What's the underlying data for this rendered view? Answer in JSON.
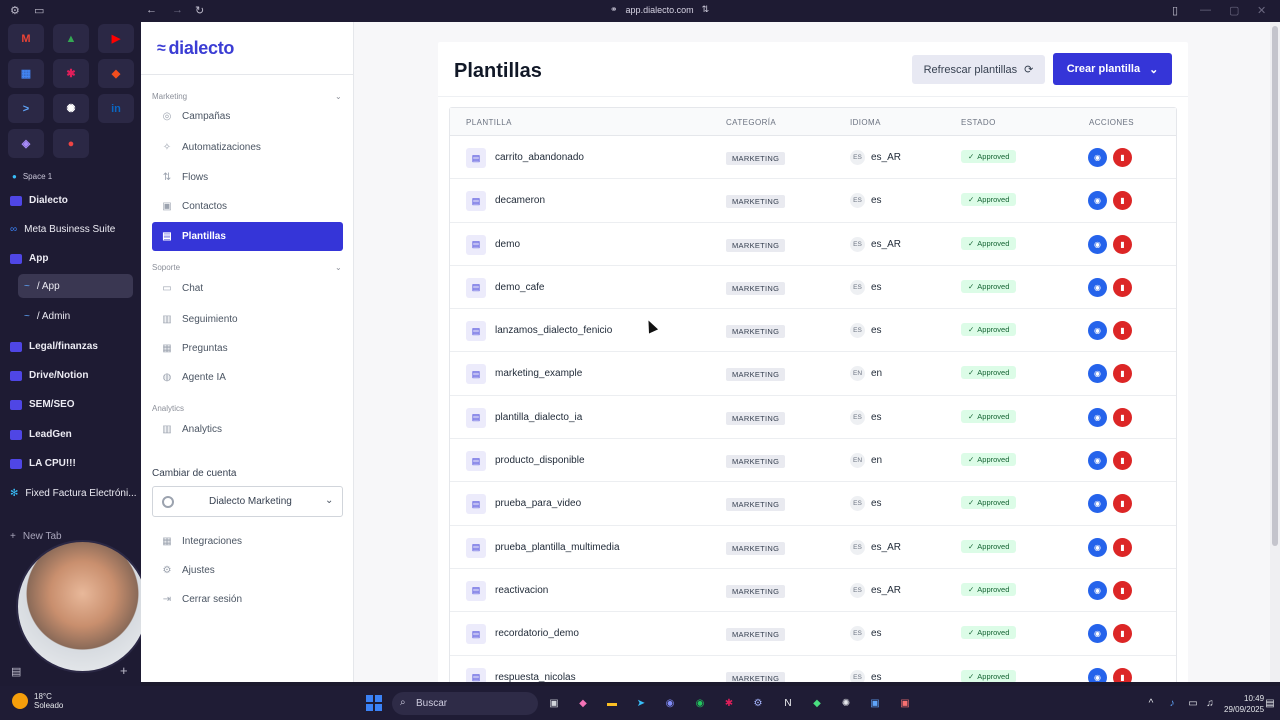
{
  "browser": {
    "url": "app.dialecto.com"
  },
  "arc_sidebar": {
    "space": "Space 1",
    "items": [
      {
        "label": "Dialecto"
      },
      {
        "label": "Meta Business Suite"
      },
      {
        "label": "App"
      },
      {
        "label": "/  App"
      },
      {
        "label": "/  Admin"
      },
      {
        "label": "Legal/finanzas"
      },
      {
        "label": "Drive/Notion"
      },
      {
        "label": "SEM/SEO"
      },
      {
        "label": "LeadGen"
      },
      {
        "label": "LA CPU!!!"
      },
      {
        "label": "Fixed Factura Electróni..."
      },
      {
        "label": "New Tab"
      }
    ]
  },
  "app": {
    "logo": "dialecto",
    "sidebar": {
      "sections": {
        "marketing": "Marketing",
        "soporte": "Soporte",
        "analytics": "Analytics"
      },
      "items": [
        {
          "label": "Campañas"
        },
        {
          "label": "Automatizaciones"
        },
        {
          "label": "Flows"
        },
        {
          "label": "Contactos"
        },
        {
          "label": "Plantillas"
        },
        {
          "label": "Chat"
        },
        {
          "label": "Seguimiento"
        },
        {
          "label": "Preguntas"
        },
        {
          "label": "Agente IA"
        },
        {
          "label": "Analytics"
        }
      ],
      "switch_account_label": "Cambiar de cuenta",
      "account": "Dialecto Marketing",
      "footer": [
        {
          "label": "Integraciones"
        },
        {
          "label": "Ajustes"
        },
        {
          "label": "Cerrar sesión"
        }
      ]
    },
    "main": {
      "title": "Plantillas",
      "refresh_label": "Refrescar plantillas",
      "create_label": "Crear plantilla",
      "columns": [
        "PLANTILLA",
        "CATEGORÍA",
        "IDIOMA",
        "ESTADO",
        "ACCIONES"
      ],
      "rows": [
        {
          "name": "carrito_abandonado",
          "category": "MARKETING",
          "code": "ES",
          "lang": "es_AR",
          "status": "Approved"
        },
        {
          "name": "decameron",
          "category": "MARKETING",
          "code": "ES",
          "lang": "es",
          "status": "Approved"
        },
        {
          "name": "demo",
          "category": "MARKETING",
          "code": "ES",
          "lang": "es_AR",
          "status": "Approved"
        },
        {
          "name": "demo_cafe",
          "category": "MARKETING",
          "code": "ES",
          "lang": "es",
          "status": "Approved"
        },
        {
          "name": "lanzamos_dialecto_fenicio",
          "category": "MARKETING",
          "code": "ES",
          "lang": "es",
          "status": "Approved"
        },
        {
          "name": "marketing_example",
          "category": "MARKETING",
          "code": "EN",
          "lang": "en",
          "status": "Approved"
        },
        {
          "name": "plantilla_dialecto_ia",
          "category": "MARKETING",
          "code": "ES",
          "lang": "es",
          "status": "Approved"
        },
        {
          "name": "producto_disponible",
          "category": "MARKETING",
          "code": "EN",
          "lang": "en",
          "status": "Approved"
        },
        {
          "name": "prueba_para_video",
          "category": "MARKETING",
          "code": "ES",
          "lang": "es",
          "status": "Approved"
        },
        {
          "name": "prueba_plantilla_multimedia",
          "category": "MARKETING",
          "code": "ES",
          "lang": "es_AR",
          "status": "Approved"
        },
        {
          "name": "reactivacion",
          "category": "MARKETING",
          "code": "ES",
          "lang": "es_AR",
          "status": "Approved"
        },
        {
          "name": "recordatorio_demo",
          "category": "MARKETING",
          "code": "ES",
          "lang": "es",
          "status": "Approved"
        },
        {
          "name": "respuesta_nicolas",
          "category": "MARKETING",
          "code": "ES",
          "lang": "es",
          "status": "Approved"
        }
      ]
    }
  },
  "taskbar": {
    "temperature": "18°C",
    "weather": "Soleado",
    "search_placeholder": "Buscar",
    "time": "10:49",
    "date": "29/09/2025"
  },
  "colors": {
    "accent": "#3535d8",
    "approved_bg": "#dcfce7",
    "view_btn": "#2563eb",
    "delete_btn": "#dc2626"
  }
}
